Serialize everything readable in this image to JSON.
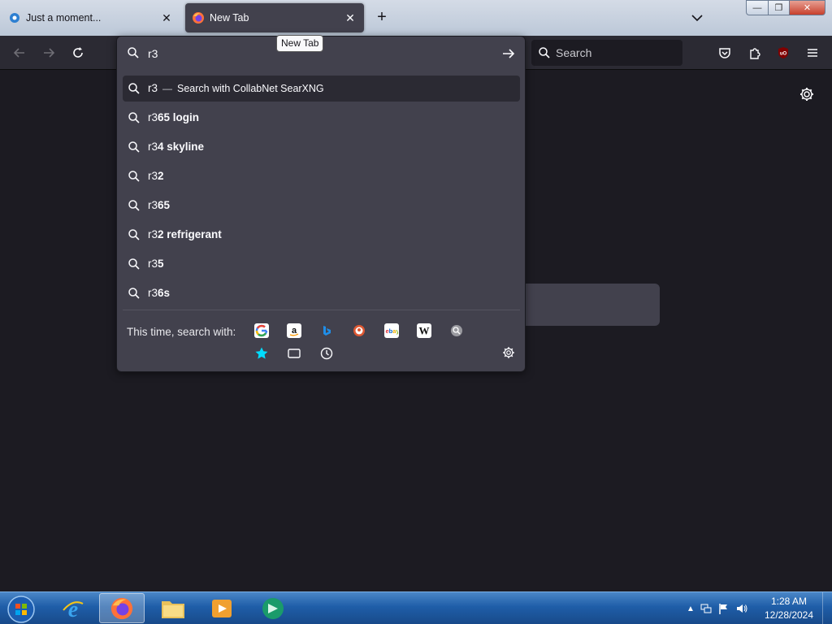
{
  "tabs": [
    {
      "label": "Just a moment...",
      "icon": "cloudflare-icon",
      "active": false
    },
    {
      "label": "New Tab",
      "icon": "firefox-icon",
      "active": true
    }
  ],
  "tooltip": "New Tab",
  "toolbar": {
    "search_placeholder": "Search"
  },
  "urlbar": {
    "value": "r3",
    "results": [
      {
        "typed": "r3",
        "suggestion": "",
        "action": "Search with CollabNet SearXNG",
        "selected": true
      },
      {
        "typed": "r3",
        "suggestion": "65 login"
      },
      {
        "typed": "r3",
        "suggestion": "4 skyline"
      },
      {
        "typed": "r3",
        "suggestion": "2"
      },
      {
        "typed": "r3",
        "suggestion": "65"
      },
      {
        "typed": "r3",
        "suggestion": "2 refrigerant"
      },
      {
        "typed": "r3",
        "suggestion": "5"
      },
      {
        "typed": "r3",
        "suggestion": "6s"
      }
    ],
    "action_separator": "—",
    "oneoff_label": "This time, search with:",
    "engines": [
      "google-icon",
      "amazon-icon",
      "bing-icon",
      "duckduckgo-icon",
      "ebay-icon",
      "wikipedia-icon",
      "searxng-icon"
    ],
    "modes": [
      "bookmarks-star-icon",
      "tabs-icon",
      "history-clock-icon"
    ]
  },
  "taskbar": {
    "apps": [
      "internet-explorer-icon",
      "firefox-icon",
      "file-explorer-icon",
      "media-player-icon",
      "app-icon"
    ],
    "time": "1:28 AM",
    "date": "12/28/2024"
  }
}
